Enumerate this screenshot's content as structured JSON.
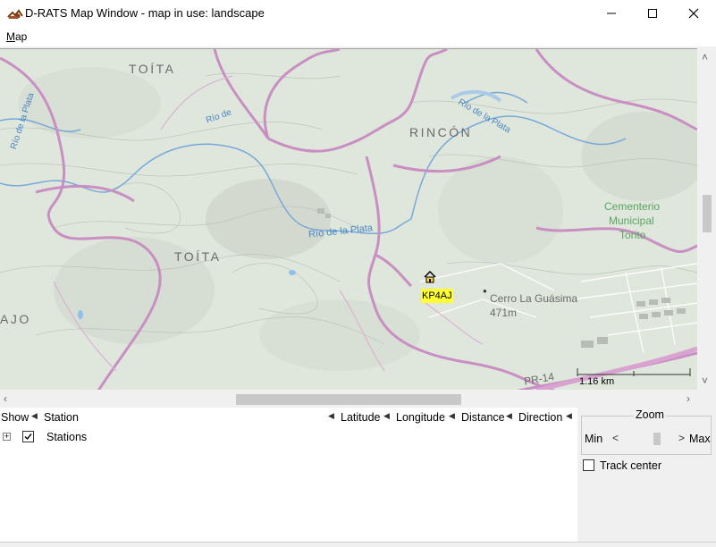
{
  "window": {
    "title": "D-RATS Map Window - map in use: landscape",
    "minimize_glyph": "─",
    "maximize_glyph": "☐",
    "close_glyph": "✕"
  },
  "menubar": {
    "map_label": "Map"
  },
  "map": {
    "place_labels": {
      "toita_top": "TOÍTA",
      "toita_mid": "TOÍTA",
      "rincon": "RINCÓN",
      "ajo": "AJO",
      "rio_plata_left": "Río de la Plata",
      "rio_de": "Río de",
      "rio_plata_center": "Río de la Plata",
      "rio_plata_right": "Río de la Plata",
      "cementerio_1": "Cementerio",
      "cementerio_2": "Municipal",
      "cementerio_3": "Torito",
      "cerro_name": "Cerro La Guásima",
      "cerro_elev": "471m",
      "road": "PR-14"
    },
    "station_marker_label": "KP4AJ",
    "scale_label": "1.16 km",
    "colors": {
      "background": "#dde4db",
      "road": "#c58dbf",
      "river": "#73a6d6",
      "label": "#6b6b6b",
      "marker_highlight": "#ffff33"
    }
  },
  "station_list": {
    "columns": {
      "show": "Show",
      "station": "Station",
      "latitude": "Latitude",
      "longitude": "Longitude",
      "distance": "Distance",
      "direction": "Direction"
    },
    "rows": [
      {
        "label": "Stations",
        "checked": true,
        "expander": "+"
      }
    ]
  },
  "zoom": {
    "title": "Zoom",
    "min_label": "Min",
    "max_label": "Max",
    "left_arrow": "<",
    "right_arrow": ">"
  },
  "track_center": {
    "label": "Track center",
    "checked": false
  }
}
